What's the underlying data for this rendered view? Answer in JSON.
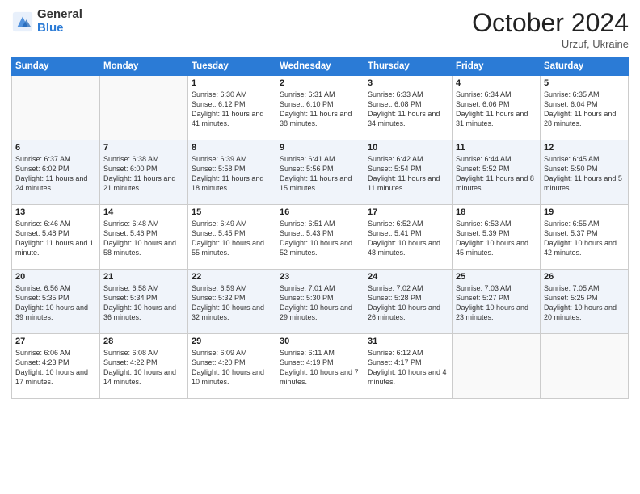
{
  "logo": {
    "general": "General",
    "blue": "Blue"
  },
  "header": {
    "month": "October 2024",
    "location": "Urzuf, Ukraine"
  },
  "weekdays": [
    "Sunday",
    "Monday",
    "Tuesday",
    "Wednesday",
    "Thursday",
    "Friday",
    "Saturday"
  ],
  "weeks": [
    [
      {
        "day": "",
        "sunrise": "",
        "sunset": "",
        "daylight": ""
      },
      {
        "day": "",
        "sunrise": "",
        "sunset": "",
        "daylight": ""
      },
      {
        "day": "1",
        "sunrise": "Sunrise: 6:30 AM",
        "sunset": "Sunset: 6:12 PM",
        "daylight": "Daylight: 11 hours and 41 minutes."
      },
      {
        "day": "2",
        "sunrise": "Sunrise: 6:31 AM",
        "sunset": "Sunset: 6:10 PM",
        "daylight": "Daylight: 11 hours and 38 minutes."
      },
      {
        "day": "3",
        "sunrise": "Sunrise: 6:33 AM",
        "sunset": "Sunset: 6:08 PM",
        "daylight": "Daylight: 11 hours and 34 minutes."
      },
      {
        "day": "4",
        "sunrise": "Sunrise: 6:34 AM",
        "sunset": "Sunset: 6:06 PM",
        "daylight": "Daylight: 11 hours and 31 minutes."
      },
      {
        "day": "5",
        "sunrise": "Sunrise: 6:35 AM",
        "sunset": "Sunset: 6:04 PM",
        "daylight": "Daylight: 11 hours and 28 minutes."
      }
    ],
    [
      {
        "day": "6",
        "sunrise": "Sunrise: 6:37 AM",
        "sunset": "Sunset: 6:02 PM",
        "daylight": "Daylight: 11 hours and 24 minutes."
      },
      {
        "day": "7",
        "sunrise": "Sunrise: 6:38 AM",
        "sunset": "Sunset: 6:00 PM",
        "daylight": "Daylight: 11 hours and 21 minutes."
      },
      {
        "day": "8",
        "sunrise": "Sunrise: 6:39 AM",
        "sunset": "Sunset: 5:58 PM",
        "daylight": "Daylight: 11 hours and 18 minutes."
      },
      {
        "day": "9",
        "sunrise": "Sunrise: 6:41 AM",
        "sunset": "Sunset: 5:56 PM",
        "daylight": "Daylight: 11 hours and 15 minutes."
      },
      {
        "day": "10",
        "sunrise": "Sunrise: 6:42 AM",
        "sunset": "Sunset: 5:54 PM",
        "daylight": "Daylight: 11 hours and 11 minutes."
      },
      {
        "day": "11",
        "sunrise": "Sunrise: 6:44 AM",
        "sunset": "Sunset: 5:52 PM",
        "daylight": "Daylight: 11 hours and 8 minutes."
      },
      {
        "day": "12",
        "sunrise": "Sunrise: 6:45 AM",
        "sunset": "Sunset: 5:50 PM",
        "daylight": "Daylight: 11 hours and 5 minutes."
      }
    ],
    [
      {
        "day": "13",
        "sunrise": "Sunrise: 6:46 AM",
        "sunset": "Sunset: 5:48 PM",
        "daylight": "Daylight: 11 hours and 1 minute."
      },
      {
        "day": "14",
        "sunrise": "Sunrise: 6:48 AM",
        "sunset": "Sunset: 5:46 PM",
        "daylight": "Daylight: 10 hours and 58 minutes."
      },
      {
        "day": "15",
        "sunrise": "Sunrise: 6:49 AM",
        "sunset": "Sunset: 5:45 PM",
        "daylight": "Daylight: 10 hours and 55 minutes."
      },
      {
        "day": "16",
        "sunrise": "Sunrise: 6:51 AM",
        "sunset": "Sunset: 5:43 PM",
        "daylight": "Daylight: 10 hours and 52 minutes."
      },
      {
        "day": "17",
        "sunrise": "Sunrise: 6:52 AM",
        "sunset": "Sunset: 5:41 PM",
        "daylight": "Daylight: 10 hours and 48 minutes."
      },
      {
        "day": "18",
        "sunrise": "Sunrise: 6:53 AM",
        "sunset": "Sunset: 5:39 PM",
        "daylight": "Daylight: 10 hours and 45 minutes."
      },
      {
        "day": "19",
        "sunrise": "Sunrise: 6:55 AM",
        "sunset": "Sunset: 5:37 PM",
        "daylight": "Daylight: 10 hours and 42 minutes."
      }
    ],
    [
      {
        "day": "20",
        "sunrise": "Sunrise: 6:56 AM",
        "sunset": "Sunset: 5:35 PM",
        "daylight": "Daylight: 10 hours and 39 minutes."
      },
      {
        "day": "21",
        "sunrise": "Sunrise: 6:58 AM",
        "sunset": "Sunset: 5:34 PM",
        "daylight": "Daylight: 10 hours and 36 minutes."
      },
      {
        "day": "22",
        "sunrise": "Sunrise: 6:59 AM",
        "sunset": "Sunset: 5:32 PM",
        "daylight": "Daylight: 10 hours and 32 minutes."
      },
      {
        "day": "23",
        "sunrise": "Sunrise: 7:01 AM",
        "sunset": "Sunset: 5:30 PM",
        "daylight": "Daylight: 10 hours and 29 minutes."
      },
      {
        "day": "24",
        "sunrise": "Sunrise: 7:02 AM",
        "sunset": "Sunset: 5:28 PM",
        "daylight": "Daylight: 10 hours and 26 minutes."
      },
      {
        "day": "25",
        "sunrise": "Sunrise: 7:03 AM",
        "sunset": "Sunset: 5:27 PM",
        "daylight": "Daylight: 10 hours and 23 minutes."
      },
      {
        "day": "26",
        "sunrise": "Sunrise: 7:05 AM",
        "sunset": "Sunset: 5:25 PM",
        "daylight": "Daylight: 10 hours and 20 minutes."
      }
    ],
    [
      {
        "day": "27",
        "sunrise": "Sunrise: 6:06 AM",
        "sunset": "Sunset: 4:23 PM",
        "daylight": "Daylight: 10 hours and 17 minutes."
      },
      {
        "day": "28",
        "sunrise": "Sunrise: 6:08 AM",
        "sunset": "Sunset: 4:22 PM",
        "daylight": "Daylight: 10 hours and 14 minutes."
      },
      {
        "day": "29",
        "sunrise": "Sunrise: 6:09 AM",
        "sunset": "Sunset: 4:20 PM",
        "daylight": "Daylight: 10 hours and 10 minutes."
      },
      {
        "day": "30",
        "sunrise": "Sunrise: 6:11 AM",
        "sunset": "Sunset: 4:19 PM",
        "daylight": "Daylight: 10 hours and 7 minutes."
      },
      {
        "day": "31",
        "sunrise": "Sunrise: 6:12 AM",
        "sunset": "Sunset: 4:17 PM",
        "daylight": "Daylight: 10 hours and 4 minutes."
      },
      {
        "day": "",
        "sunrise": "",
        "sunset": "",
        "daylight": ""
      },
      {
        "day": "",
        "sunrise": "",
        "sunset": "",
        "daylight": ""
      }
    ]
  ]
}
